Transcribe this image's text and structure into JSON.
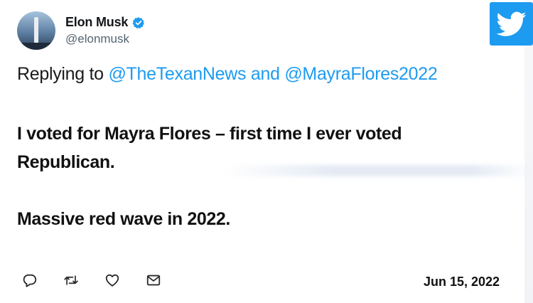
{
  "author": {
    "name": "Elon Musk",
    "handle": "@elonmusk"
  },
  "replying": {
    "prefix": "Replying to",
    "mention_1": "@TheTexanNews",
    "conjunction": "and",
    "mention_2": "@MayraFlores2022"
  },
  "tweet": {
    "paragraphs": [
      "I voted for Mayra Flores – first time I ever voted Republican.",
      "Massive red wave in 2022."
    ],
    "date": "Jun 15, 2022"
  },
  "icons": {
    "brand": "twitter-bird-icon",
    "verified": "verified-badge-icon",
    "actions": [
      "reply-icon",
      "retweet-icon",
      "like-icon",
      "direct-message-icon"
    ]
  },
  "colors": {
    "twitter_blue": "#1d9bf0",
    "mention": "#1d9bf0",
    "text": "#111111",
    "secondary_text": "#536471"
  }
}
